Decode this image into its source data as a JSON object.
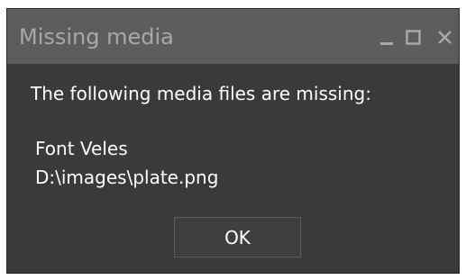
{
  "window": {
    "title": "Missing media",
    "controls": [
      {
        "name": "minimize",
        "icon": "minimize-icon"
      },
      {
        "name": "maximize",
        "icon": "maximize-icon"
      },
      {
        "name": "close",
        "icon": "close-icon"
      }
    ]
  },
  "body": {
    "message": "The following media files are missing:",
    "files": [
      "Font Veles",
      "D:\\images\\plate.png"
    ]
  },
  "actions": {
    "ok_label": "OK"
  },
  "colors": {
    "titlebar_bg": "#5d5d5d",
    "title_text": "#a8a8a8",
    "dialog_bg": "#3a3a3a",
    "text": "#ffffff",
    "button_border": "#5c5c5c"
  }
}
